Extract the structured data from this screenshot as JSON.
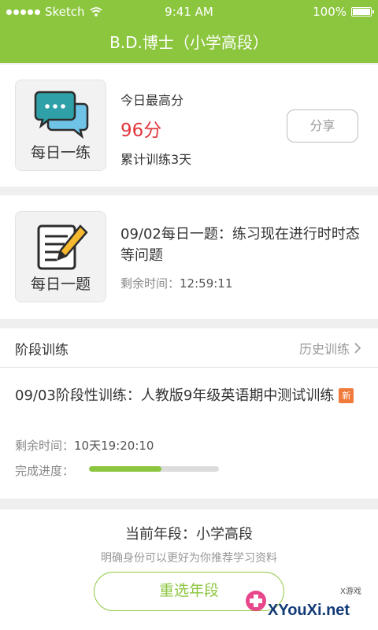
{
  "statusbar": {
    "carrier": "Sketch",
    "time": "9:41 AM",
    "battery": "100%"
  },
  "header": {
    "title": "B.D.博士（小学高段）"
  },
  "daily_practice": {
    "tile_label": "每日一练",
    "score_title": "今日最高分",
    "score_value": "96分",
    "streak": "累计训练3天",
    "share_label": "分享"
  },
  "daily_question": {
    "tile_label": "每日一题",
    "title": "09/02每日一题：练习现在进行时时态等问题",
    "remain_label": "剩余时间：",
    "remain_value": "12:59:11"
  },
  "stage_training": {
    "section_title": "阶段训练",
    "history_label": "历史训练",
    "title": "09/03阶段性训练：人教版9年级英语期中测试训练",
    "badge": "新",
    "remain_label": "剩余时间：",
    "remain_value": "10天19:20:10",
    "progress_label": "完成进度：",
    "progress_fraction": 0.56
  },
  "grade": {
    "current": "当前年段：小学高段",
    "hint": "明确身份可以更好为你推荐学习资料",
    "reselect_label": "重选年段"
  },
  "watermark": {
    "site": "XYouXi.net",
    "small": "X游戏"
  },
  "colors": {
    "accent": "#8cc63f",
    "score": "#e0383e",
    "badge": "#f07a3a"
  }
}
